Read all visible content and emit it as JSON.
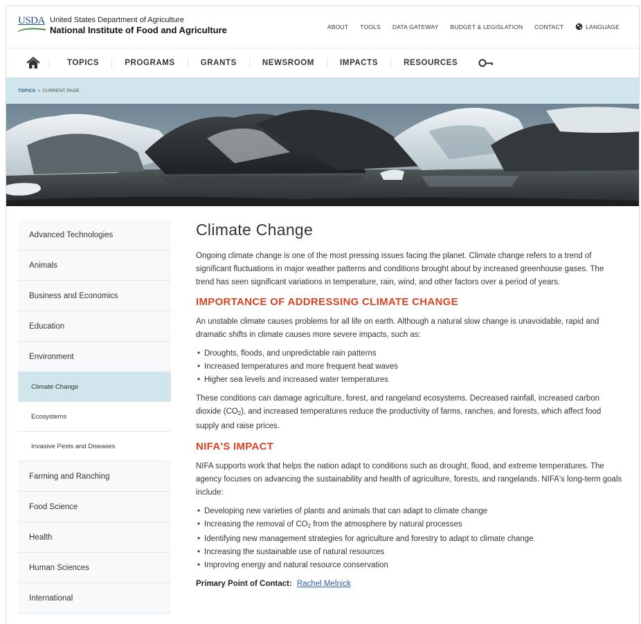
{
  "header": {
    "usda": "USDA",
    "department": "United States Department of Agriculture",
    "agency": "National Institute of Food and Agriculture",
    "utility_nav": [
      "ABOUT",
      "TOOLS",
      "DATA GATEWAY",
      "BUDGET & LEGISLATION",
      "CONTACT"
    ],
    "language": "LANGUAGE"
  },
  "nav": {
    "items": [
      "TOPICS",
      "PROGRAMS",
      "GRANTS",
      "NEWSROOM",
      "IMPACTS",
      "RESOURCES"
    ]
  },
  "breadcrumb": {
    "root": "TOPICS",
    "separator": ">",
    "current": "CURRENT PAGE"
  },
  "sidebar": {
    "items": [
      "Advanced Technologies",
      "Animals",
      "Business and Economics",
      "Education",
      "Environment"
    ],
    "subitems": [
      "Climate Change",
      "Ecosystems",
      "Invasive Pests and Diseases"
    ],
    "items_after": [
      "Farming and Ranching",
      "Food Science",
      "Health",
      "Human Sciences",
      "International"
    ]
  },
  "main": {
    "title": "Climate Change",
    "intro": "Ongoing climate change is one of the most pressing issues facing the planet. Climate change refers to a trend of significant fluctuations in major weather patterns and conditions brought about by increased greenhouse gases. The trend has seen significant variations in temperature, rain, wind, and other factors over a period of years.",
    "section1_heading": "IMPORTANCE OF ADDRESSING CLIMATE CHANGE",
    "section1_para": "An unstable climate causes problems for all life on earth. Although a natural slow change is unavoidable, rapid and dramatic shifts in climate causes more severe impacts, such as:",
    "section1_bullets": [
      "Droughts, floods, and unpredictable rain patterns",
      "Increased temperatures and more frequent heat waves",
      "Higher sea levels and increased water temperatures"
    ],
    "section1_after_a": "These conditions can damage agriculture, forest, and rangeland ecosystems. Decreased rainfall, increased carbon dioxide (CO",
    "section1_after_sub": "2",
    "section1_after_b": "), and increased temperatures reduce the productivity of farms, ranches, and forests, which affect food supply and raise prices.",
    "section2_heading": "NIFA'S IMPACT",
    "section2_para": "NIFA supports work that helps the nation adapt to conditions such as drought, flood, and extreme temperatures. The agency focuses on advancing the sustainability and health of agriculture, forests, and rangelands. NIFA's long-term goals include:",
    "section2_bullets": {
      "b1": "Developing new varieties of plants and animals that can adapt to climate change",
      "b2_a": "Increasing the removal of CO",
      "b2_sub": "2",
      "b2_b": " from the atmosphere by natural processes",
      "b3": "Identifying new management strategies for agriculture and forestry to adapt to climate change",
      "b4": "Increasing the sustainable use of natural resources",
      "b5": "Improving energy and natural resource conservation"
    },
    "contact_label": "Primary Point of Contact:",
    "contact_name": "Rachel Melnick"
  },
  "colors": {
    "accent_red": "#d84326",
    "breadcrumb_bg": "#d1e5ec",
    "link_blue": "#2a5da8",
    "usda_blue": "#2b4a84",
    "usda_green": "#3f8a3c"
  },
  "icons": [
    "usda-logo",
    "globe-icon",
    "home-icon",
    "search-icon"
  ]
}
